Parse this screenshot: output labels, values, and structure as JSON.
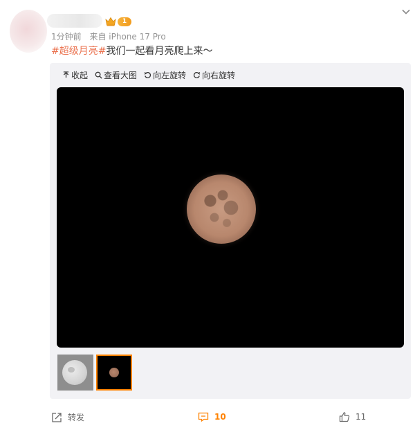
{
  "post": {
    "level_badge": "1",
    "time": "1分钟前",
    "source": "来自 iPhone 17 Pro",
    "topic": "#超级月亮#",
    "text": "我们一起看月亮爬上来～"
  },
  "media": {
    "tools": [
      {
        "label": "收起",
        "icon": "collapse-icon"
      },
      {
        "label": "查看大图",
        "icon": "magnify-icon"
      },
      {
        "label": "向左旋转",
        "icon": "rotate-left-icon"
      },
      {
        "label": "向右旋转",
        "icon": "rotate-right-icon"
      }
    ],
    "selected_thumb": 2
  },
  "actions": {
    "repost_label": "转发",
    "comment_count": "10",
    "like_count": "11"
  },
  "colors": {
    "topic": "#eb7350",
    "accent": "#ff8200",
    "meta": "#939393"
  }
}
